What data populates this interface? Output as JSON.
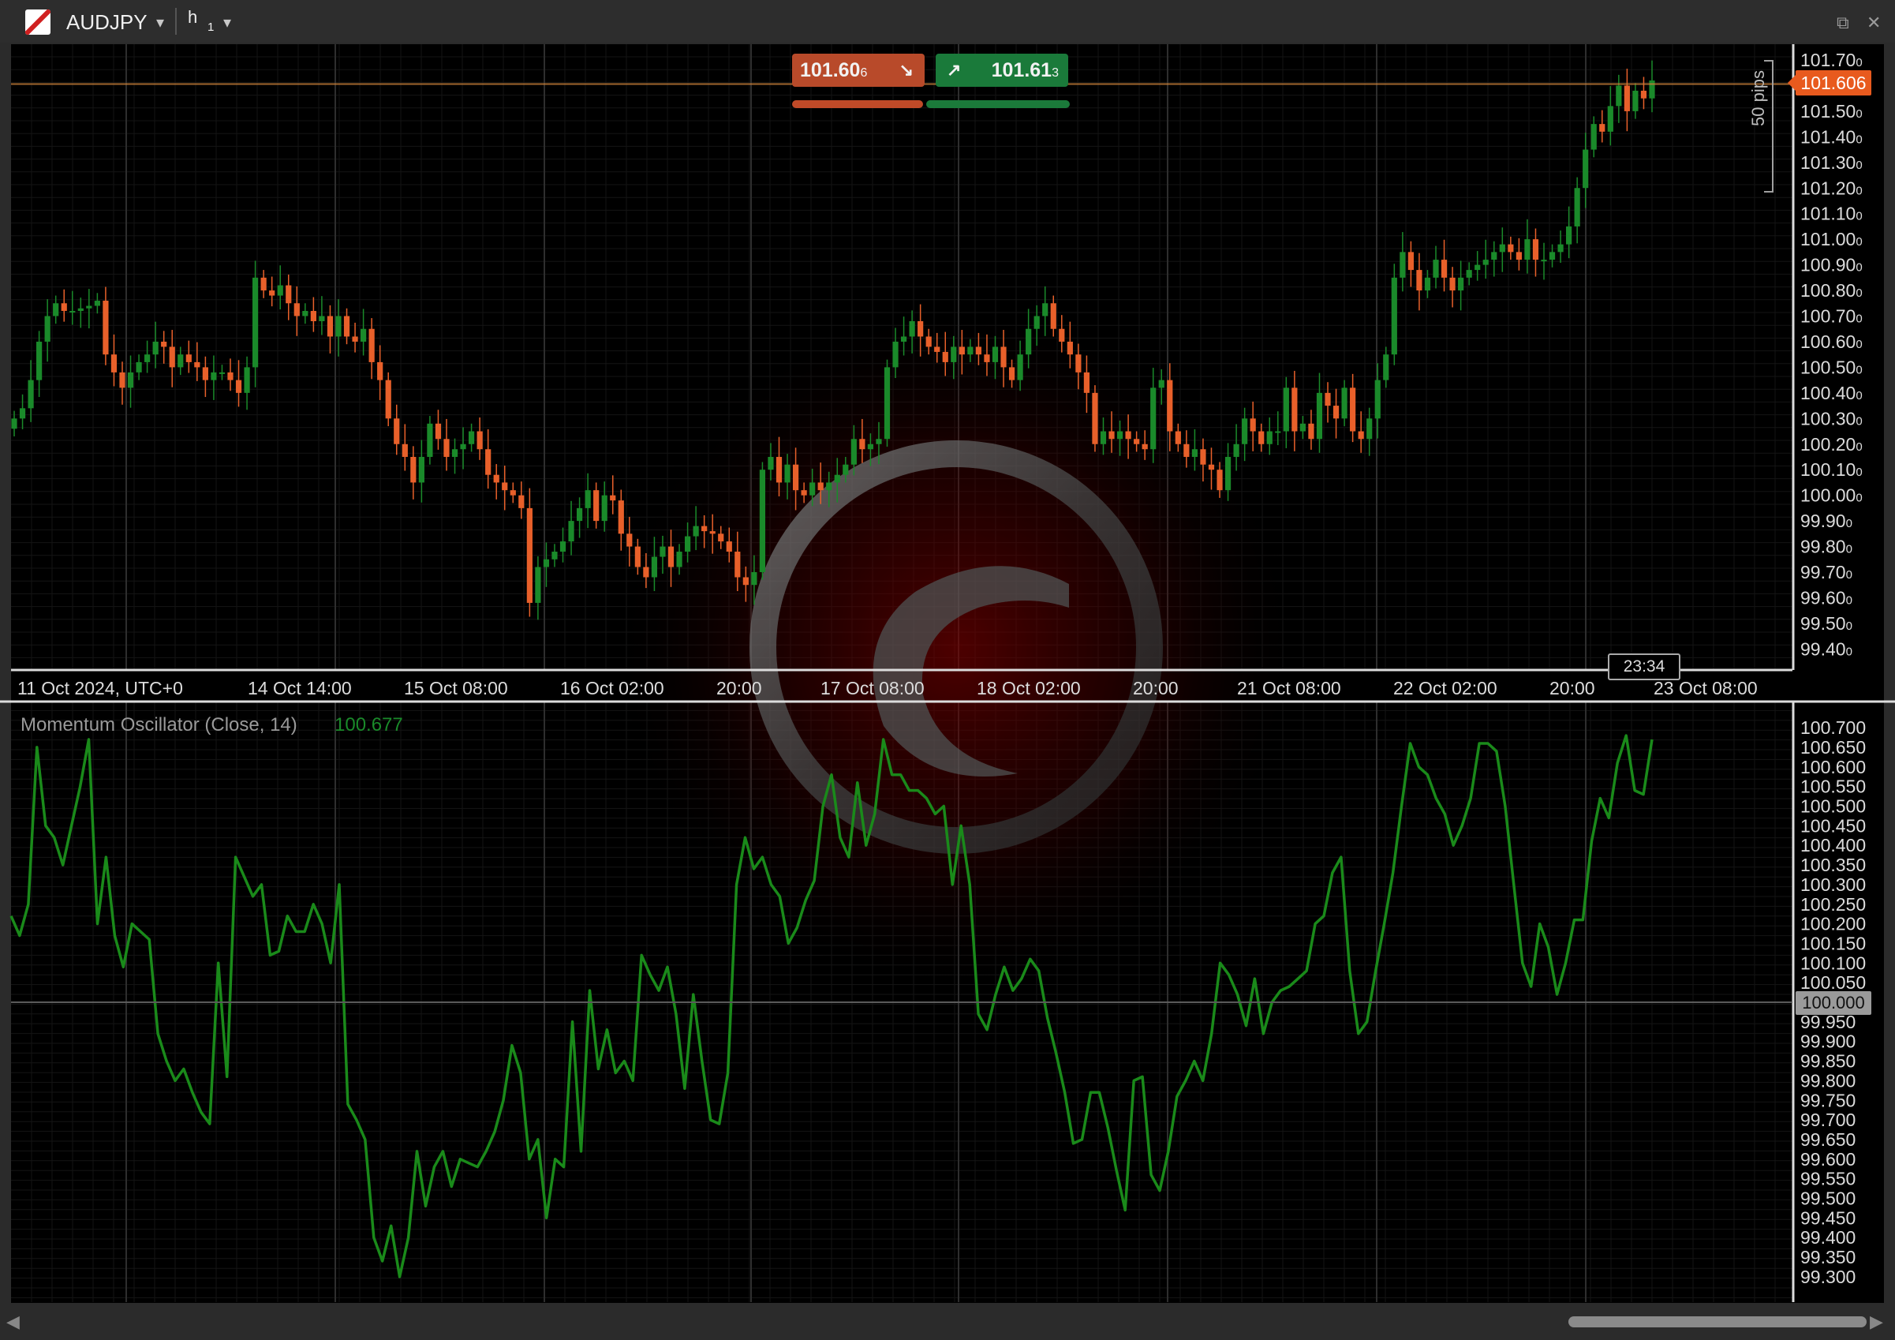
{
  "toolbar": {
    "symbol": "AUDJPY",
    "timeframe": "h",
    "timeframe_period": "1",
    "dropdown_glyph": "▾",
    "popout_icon": "popout-icon",
    "close_icon": "close-icon"
  },
  "quotes": {
    "sell_main": "101.60",
    "sell_pip": "6",
    "buy_main": "101.61",
    "buy_pip": "3",
    "sell_arrow": "↘",
    "buy_arrow": "↗"
  },
  "price_axis_labels": [
    "101.70",
    "101.60",
    "101.50",
    "101.40",
    "101.30",
    "101.20",
    "101.10",
    "101.00",
    "100.90",
    "100.80",
    "100.70",
    "100.60",
    "100.50",
    "100.40",
    "100.30",
    "100.20",
    "100.10",
    "100.00",
    "99.90",
    "99.80",
    "99.70",
    "99.60",
    "99.50",
    "99.40"
  ],
  "price_axis_suffix": "0",
  "current_price_label": "101.606",
  "pips_label": "50 pips",
  "countdown_label": "23:34",
  "time_axis": [
    "11 Oct 2024, UTC+0",
    "14 Oct 14:00",
    "15 Oct 08:00",
    "16 Oct 02:00",
    "20:00",
    "17 Oct 08:00",
    "18 Oct 02:00",
    "20:00",
    "21 Oct 08:00",
    "22 Oct 02:00",
    "20:00",
    "23 Oct 08:00"
  ],
  "indicator": {
    "title": "Momentum Oscillator (Close, 14)",
    "value": "100.677",
    "axis_labels": [
      "100.700",
      "100.650",
      "100.600",
      "100.550",
      "100.500",
      "100.450",
      "100.400",
      "100.350",
      "100.300",
      "100.250",
      "100.200",
      "100.150",
      "100.100",
      "100.050",
      "100.000",
      "99.950",
      "99.900",
      "99.850",
      "99.800",
      "99.750",
      "99.700",
      "99.650",
      "99.600",
      "99.550",
      "99.500",
      "99.450",
      "99.400",
      "99.350",
      "99.300"
    ],
    "zero_label": "100.000"
  },
  "colors": {
    "up": "#1a8a2a",
    "down": "#e8602a",
    "momentum_line": "#1a8a1a",
    "price_line": "#c8803a"
  },
  "chart_data": [
    {
      "type": "candlestick",
      "title": "AUDJPY h1",
      "ylim": [
        99.35,
        101.75
      ],
      "x_labels": [
        "11 Oct 2024, UTC+0",
        "14 Oct 14:00",
        "15 Oct 08:00",
        "16 Oct 02:00",
        "20:00",
        "17 Oct 08:00",
        "18 Oct 02:00",
        "20:00",
        "21 Oct 08:00",
        "22 Oct 02:00",
        "20:00",
        "23 Oct 08:00"
      ],
      "close": [
        100.3,
        100.34,
        100.45,
        100.6,
        100.7,
        100.75,
        100.72,
        100.72,
        100.73,
        100.74,
        100.76,
        100.55,
        100.48,
        100.42,
        100.48,
        100.52,
        100.55,
        100.6,
        100.58,
        100.5,
        100.55,
        100.52,
        100.5,
        100.45,
        100.48,
        100.48,
        100.45,
        100.4,
        100.5,
        100.85,
        100.8,
        100.78,
        100.82,
        100.75,
        100.7,
        100.72,
        100.68,
        100.7,
        100.62,
        100.7,
        100.62,
        100.6,
        100.65,
        100.52,
        100.45,
        100.3,
        100.2,
        100.15,
        100.05,
        100.15,
        100.28,
        100.22,
        100.15,
        100.18,
        100.2,
        100.25,
        100.18,
        100.08,
        100.05,
        100.02,
        100.0,
        99.95,
        99.58,
        99.72,
        99.75,
        99.78,
        99.82,
        99.9,
        99.95,
        100.02,
        99.9,
        100.0,
        99.98,
        99.85,
        99.8,
        99.72,
        99.68,
        99.76,
        99.8,
        99.72,
        99.78,
        99.84,
        99.88,
        99.86,
        99.85,
        99.82,
        99.78,
        99.68,
        99.65,
        99.7,
        100.1,
        100.15,
        100.05,
        100.12,
        100.02,
        100.0,
        100.05,
        100.02,
        100.05,
        100.08,
        100.12,
        100.22,
        100.18,
        100.2,
        100.22,
        100.5,
        100.6,
        100.62,
        100.68,
        100.62,
        100.58,
        100.56,
        100.52,
        100.58,
        100.55,
        100.58,
        100.55,
        100.52,
        100.58,
        100.5,
        100.45,
        100.55,
        100.65,
        100.7,
        100.75,
        100.65,
        100.6,
        100.55,
        100.48,
        100.4,
        100.2,
        100.25,
        100.22,
        100.25,
        100.22,
        100.2,
        100.18,
        100.42,
        100.45,
        100.25,
        100.2,
        100.15,
        100.18,
        100.12,
        100.1,
        100.02,
        100.15,
        100.2,
        100.3,
        100.25,
        100.2,
        100.25,
        100.25,
        100.42,
        100.25,
        100.28,
        100.22,
        100.4,
        100.35,
        100.3,
        100.42,
        100.25,
        100.22,
        100.3,
        100.45,
        100.55,
        100.85,
        100.95,
        100.88,
        100.8,
        100.85,
        100.92,
        100.85,
        100.8,
        100.85,
        100.88,
        100.9,
        100.92,
        100.95,
        100.98,
        100.95,
        100.92,
        101.0,
        100.92,
        100.92,
        100.95,
        100.98,
        101.05,
        101.2,
        101.35,
        101.45,
        101.42,
        101.52,
        101.6,
        101.5,
        101.58,
        101.55,
        101.62
      ]
    },
    {
      "type": "line",
      "title": "Momentum Oscillator (Close, 14)",
      "ylim": [
        99.27,
        100.73
      ],
      "series": [
        {
          "name": "Momentum Oscillator (Close, 14)",
          "values": [
            100.22,
            100.17,
            100.25,
            100.65,
            100.45,
            100.42,
            100.35,
            100.45,
            100.55,
            100.67,
            100.2,
            100.37,
            100.17,
            100.09,
            100.2,
            100.18,
            100.16,
            99.92,
            99.85,
            99.8,
            99.83,
            99.77,
            99.72,
            99.69,
            100.1,
            99.81,
            100.37,
            100.32,
            100.27,
            100.3,
            100.12,
            100.13,
            100.22,
            100.18,
            100.18,
            100.25,
            100.2,
            100.1,
            100.3,
            99.74,
            99.7,
            99.65,
            99.4,
            99.34,
            99.43,
            99.3,
            99.4,
            99.62,
            99.48,
            99.58,
            99.62,
            99.53,
            99.6,
            99.59,
            99.58,
            99.62,
            99.67,
            99.75,
            99.89,
            99.82,
            99.6,
            99.65,
            99.45,
            99.6,
            99.58,
            99.95,
            99.62,
            100.03,
            99.83,
            99.93,
            99.82,
            99.85,
            99.8,
            100.12,
            100.07,
            100.03,
            100.09,
            99.97,
            99.78,
            100.02,
            99.85,
            99.7,
            99.69,
            99.82,
            100.3,
            100.42,
            100.34,
            100.37,
            100.3,
            100.27,
            100.15,
            100.19,
            100.26,
            100.31,
            100.5,
            100.58,
            100.42,
            100.37,
            100.56,
            100.4,
            100.48,
            100.67,
            100.58,
            100.58,
            100.54,
            100.54,
            100.52,
            100.48,
            100.5,
            100.3,
            100.45,
            100.3,
            99.97,
            99.93,
            100.02,
            100.09,
            100.03,
            100.06,
            100.11,
            100.08,
            99.96,
            99.87,
            99.77,
            99.64,
            99.65,
            99.77,
            99.77,
            99.68,
            99.57,
            99.47,
            99.8,
            99.81,
            99.56,
            99.52,
            99.62,
            99.76,
            99.8,
            99.85,
            99.8,
            99.92,
            100.1,
            100.07,
            100.02,
            99.94,
            100.06,
            99.92,
            100.0,
            100.03,
            100.04,
            100.06,
            100.08,
            100.2,
            100.22,
            100.33,
            100.37,
            100.08,
            99.92,
            99.95,
            100.08,
            100.2,
            100.33,
            100.5,
            100.66,
            100.6,
            100.58,
            100.52,
            100.48,
            100.4,
            100.45,
            100.52,
            100.66,
            100.66,
            100.64,
            100.5,
            100.3,
            100.1,
            100.04,
            100.2,
            100.14,
            100.02,
            100.1,
            100.21,
            100.21,
            100.41,
            100.52,
            100.47,
            100.61,
            100.68,
            100.54,
            100.53,
            100.67
          ]
        }
      ]
    }
  ]
}
